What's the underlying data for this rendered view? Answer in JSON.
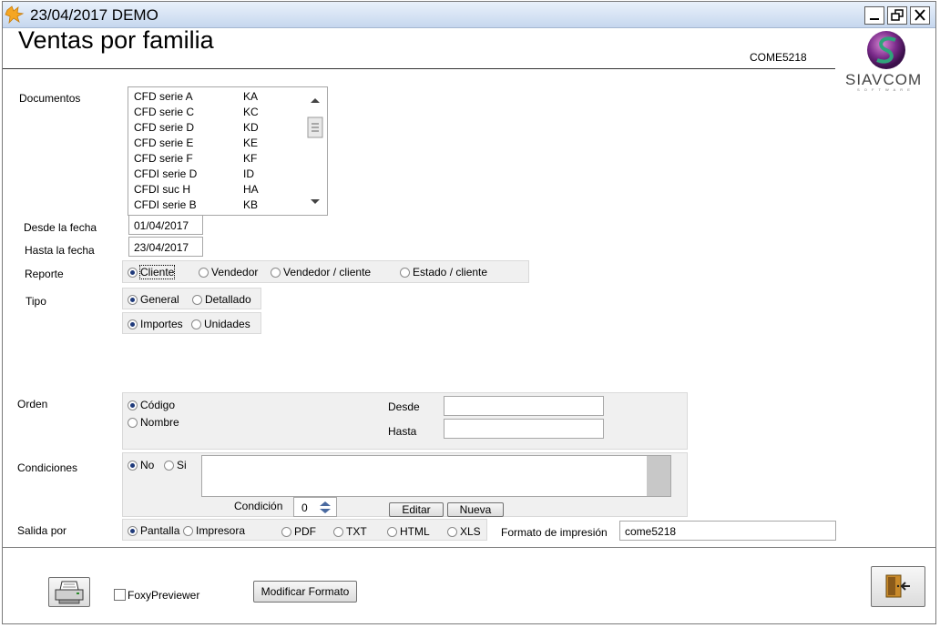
{
  "window": {
    "title": "23/04/2017  DEMO"
  },
  "header": {
    "title": "Ventas por familia",
    "report_code": "COME5218",
    "logo_text": "SIAVCOM",
    "logo_subtext": "S O F T W A R E"
  },
  "documentos": {
    "label": "Documentos",
    "items": [
      {
        "name": "CFD serie A",
        "code": "KA"
      },
      {
        "name": "CFD serie C",
        "code": "KC"
      },
      {
        "name": "CFD serie D",
        "code": "KD"
      },
      {
        "name": "CFD serie E",
        "code": "KE"
      },
      {
        "name": "CFD serie F",
        "code": "KF"
      },
      {
        "name": "CFDI  serie D",
        "code": "ID"
      },
      {
        "name": "CFDI  suc  H",
        "code": "HA"
      },
      {
        "name": "CFDI serie B",
        "code": "KB"
      }
    ]
  },
  "fechas": {
    "desde_label": "Desde la fecha",
    "desde_value": "01/04/2017",
    "hasta_label": "Hasta la fecha",
    "hasta_value": "23/04/2017"
  },
  "reporte": {
    "label": "Reporte",
    "options": [
      "Cliente",
      "Vendedor",
      "Vendedor / cliente",
      "Estado / cliente"
    ],
    "selected": "Cliente"
  },
  "tipo": {
    "label": "Tipo",
    "options": [
      "General",
      "Detallado"
    ],
    "selected": "General",
    "options2": [
      "Importes",
      "Unidades"
    ],
    "selected2": "Importes"
  },
  "orden": {
    "label": "Orden",
    "options": [
      "Código",
      "Nombre"
    ],
    "selected": "Código",
    "desde_label": "Desde",
    "desde_value": "",
    "hasta_label": "Hasta",
    "hasta_value": ""
  },
  "condiciones": {
    "label": "Condiciones",
    "options": [
      "No",
      "Si"
    ],
    "selected": "No",
    "condicion_label": "Condición",
    "condicion_value": "0",
    "editar_label": "Editar",
    "nueva_label": "Nueva"
  },
  "salida": {
    "label": "Salida por",
    "options": [
      "Pantalla",
      "Impresora",
      "PDF",
      "TXT",
      "HTML",
      "XLS"
    ],
    "selected": "Pantalla",
    "formato_label": "Formato de impresión",
    "formato_value": "come5218"
  },
  "footer": {
    "foxy_label": "FoxyPreviewer",
    "foxy_checked": false,
    "modificar_label": "Modificar Formato"
  }
}
